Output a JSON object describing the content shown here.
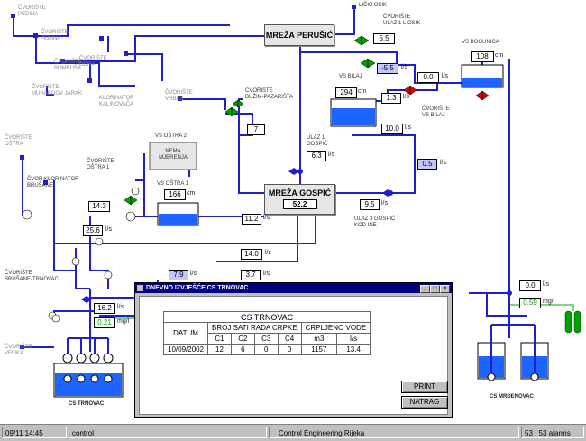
{
  "colors": {
    "pipe": "#1f1fcc",
    "water": "#1e64ff",
    "valve_green": "#00a000",
    "valve_red": "#e00000",
    "flow_line": "#00aa00"
  },
  "networks": {
    "perusic": "MREŽA PERUŠIĆ",
    "gospic": "MREŽA GOSPIĆ",
    "gospic_value": "52.2"
  },
  "nodes": {
    "pedina": "ČVORIŠTE\nPEDINA",
    "bogdanic": "ČVORIŠTE\nPEDINA",
    "bogdanic2": "ČVORIŠTE\nODRA",
    "bogdanic3": "ČVORIŠTE\nBOMBUŠA",
    "muhardov": "ČVORIŠTE\nMUHARDOV JARAK",
    "klorinator_kalinovaca": "KLORINATOR\nKALINOVAČA",
    "vrbas": "ČVORIŠTE\nVRBAS",
    "buzim": "ČVORIŠTE\nBUŽIM-PAZARIŠTA",
    "licki_osik": "LIČKI OSIK",
    "ulaz1_losik": "ČVORIŠTE\nULAZ 1 L.OSIK",
    "vs_bogunica": "VS BOGUNICA",
    "vs_bilaj": "VS BILAJ",
    "cv_bilaj": "ČVORIŠTE\nVS BILAJ",
    "ulaz1_gospic": "ULAZ 1\nGOSPIĆ",
    "ulaz3_gospic": "ULAZ 3 GOSPIĆ\nKOD INE",
    "vs_ostra2": "VS OŠTRA 2",
    "nema_mjerenja": "NEMA\nMJERENJA",
    "vs_ostra1": "VS OŠTRA 1",
    "cv_ostra1": "ČVORIŠTE\nOŠTRA 1",
    "cv_ostra": "ČVORIŠTE\nOŠTRA",
    "brusane": "ČVORIŠTE\nBRUŠANE",
    "cvor_klorinator": "ČVOR KLORINATOR\nBRUŠANE",
    "brusane_trnovac": "ČVORIŠTE\nBRUŠANE-TRNOVAC",
    "velika": "ČVORIŠTE\nVELIKA",
    "cs_trnovac": "CS TRNOVAC",
    "cs_mrdenovac": "CS MRĐENOVAC"
  },
  "readings": {
    "losik_55": "5.5",
    "losik_neg": "-5.5",
    "bogunica_00": "0.0",
    "bogunica_108": "108",
    "bilaj_level": "294",
    "bilaj_13": "1.3",
    "bilaj_100": "10.0",
    "bilaj_05": "0.5",
    "buzim_7": "7",
    "ulaz1_63": "6.3",
    "ostra_level": "166",
    "ostra_143": "14.3",
    "brusane_256": "25.6",
    "gospic_112": "11.2",
    "ulaz3_95": "9.5",
    "flow_140": "14.0",
    "flow_79": "7.9",
    "flow_37": "3.7",
    "trnovac_162": "16.2",
    "trnovac_021": "0.21",
    "mrd_00": "0.0",
    "mrd_059": "0.59"
  },
  "units": {
    "ls": "l/s",
    "cm": "cm",
    "mgl": "mg/l"
  },
  "dialog": {
    "title": "DNEVNO IZVJEŠĆE CS TRNOVAC",
    "report_title": "CS TRNOVAC",
    "headers": {
      "date": "DATUM",
      "pumps": "BROJ SATI RADA CRPKE",
      "pumped": "CRPLJENO VODE"
    },
    "sub_headers": [
      "C1",
      "C2",
      "C3",
      "C4",
      "m3",
      "l/s"
    ],
    "row": [
      "10/09/2002",
      "12",
      "6",
      "0",
      "0",
      "1157",
      "13.4"
    ],
    "print_label": "PRINT",
    "back_label": "NATRAG"
  },
  "status_bar": {
    "time": "09/11 14:45",
    "user": "control",
    "company": "Control Engineering Rijeka",
    "alarms": "53 : 53 alarms"
  }
}
